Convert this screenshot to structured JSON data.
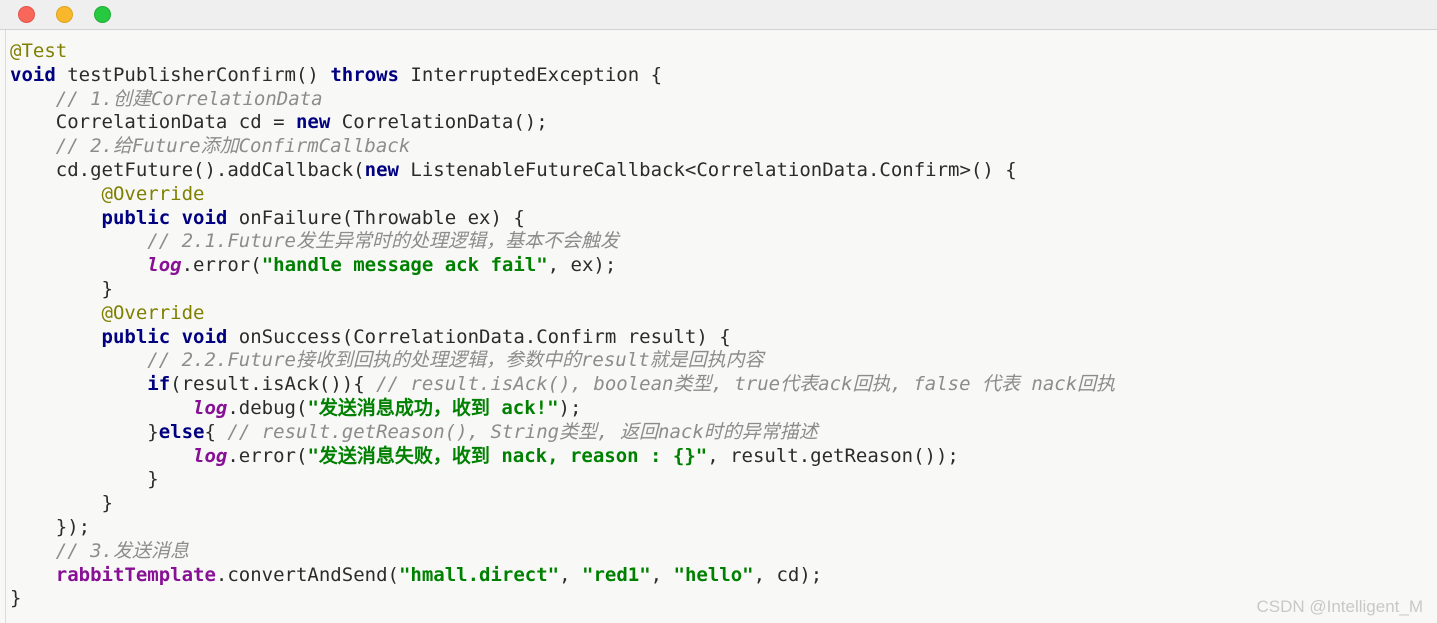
{
  "window": {
    "controls": [
      {
        "name": "close",
        "color": "#f9675a"
      },
      {
        "name": "minimize",
        "color": "#f9b82b"
      },
      {
        "name": "maximize",
        "color": "#26c940"
      }
    ]
  },
  "watermark": "CSDN @Intelligent_M",
  "editor": {
    "language": "java",
    "colors": {
      "background": "#f8f9f7",
      "text": "#2b2b2b",
      "keyword": "#000080",
      "annotation": "#808000",
      "comment": "#8c8c8c",
      "string": "#008000",
      "field": "#871094"
    },
    "lines": [
      {
        "n": 1,
        "indent": 0,
        "tokens": [
          {
            "t": "ann",
            "v": "@Test"
          }
        ]
      },
      {
        "n": 2,
        "indent": 0,
        "tokens": [
          {
            "t": "kw",
            "v": "void"
          },
          {
            "t": "pln",
            "v": " testPublisherConfirm() "
          },
          {
            "t": "kw",
            "v": "throws"
          },
          {
            "t": "pln",
            "v": " InterruptedException {"
          }
        ]
      },
      {
        "n": 3,
        "indent": 1,
        "tokens": [
          {
            "t": "cmt",
            "v": "// 1.创建CorrelationData"
          }
        ]
      },
      {
        "n": 4,
        "indent": 1,
        "tokens": [
          {
            "t": "pln",
            "v": "CorrelationData cd = "
          },
          {
            "t": "kw",
            "v": "new"
          },
          {
            "t": "pln",
            "v": " CorrelationData();"
          }
        ]
      },
      {
        "n": 5,
        "indent": 1,
        "tokens": [
          {
            "t": "cmt",
            "v": "// 2.给Future添加ConfirmCallback"
          }
        ]
      },
      {
        "n": 6,
        "indent": 1,
        "tokens": [
          {
            "t": "pln",
            "v": "cd.getFuture().addCallback("
          },
          {
            "t": "kw",
            "v": "new"
          },
          {
            "t": "pln",
            "v": " ListenableFutureCallback<CorrelationData.Confirm>() {"
          }
        ]
      },
      {
        "n": 7,
        "indent": 2,
        "tokens": [
          {
            "t": "ann",
            "v": "@Override"
          }
        ]
      },
      {
        "n": 8,
        "indent": 2,
        "tokens": [
          {
            "t": "kw",
            "v": "public void"
          },
          {
            "t": "pln",
            "v": " onFailure(Throwable ex) {"
          }
        ]
      },
      {
        "n": 9,
        "indent": 3,
        "tokens": [
          {
            "t": "cmt",
            "v": "// 2.1.Future发生异常时的处理逻辑，基本不会触发"
          }
        ]
      },
      {
        "n": 10,
        "indent": 3,
        "tokens": [
          {
            "t": "fld",
            "v": "log"
          },
          {
            "t": "pln",
            "v": ".error("
          },
          {
            "t": "str",
            "v": "\"handle message ack fail\""
          },
          {
            "t": "pln",
            "v": ", ex);"
          }
        ]
      },
      {
        "n": 11,
        "indent": 2,
        "tokens": [
          {
            "t": "pln",
            "v": "}"
          }
        ]
      },
      {
        "n": 12,
        "indent": 2,
        "tokens": [
          {
            "t": "ann",
            "v": "@Override"
          }
        ]
      },
      {
        "n": 13,
        "indent": 2,
        "tokens": [
          {
            "t": "kw",
            "v": "public void"
          },
          {
            "t": "pln",
            "v": " onSuccess(CorrelationData.Confirm result) {"
          }
        ]
      },
      {
        "n": 14,
        "indent": 3,
        "tokens": [
          {
            "t": "cmt",
            "v": "// 2.2.Future接收到回执的处理逻辑，参数中的result就是回执内容"
          }
        ]
      },
      {
        "n": 15,
        "indent": 3,
        "tokens": [
          {
            "t": "kw",
            "v": "if"
          },
          {
            "t": "pln",
            "v": "(result.isAck()){ "
          },
          {
            "t": "cmt",
            "v": "// result.isAck(), boolean类型, true代表ack回执, false 代表 nack回执"
          }
        ]
      },
      {
        "n": 16,
        "indent": 4,
        "tokens": [
          {
            "t": "fld",
            "v": "log"
          },
          {
            "t": "pln",
            "v": ".debug("
          },
          {
            "t": "str",
            "v": "\"发送消息成功，收到 ack!\""
          },
          {
            "t": "pln",
            "v": ");"
          }
        ]
      },
      {
        "n": 17,
        "indent": 3,
        "tokens": [
          {
            "t": "pln",
            "v": "}"
          },
          {
            "t": "kw",
            "v": "else"
          },
          {
            "t": "pln",
            "v": "{ "
          },
          {
            "t": "cmt",
            "v": "// result.getReason(), String类型, 返回nack时的异常描述"
          }
        ]
      },
      {
        "n": 18,
        "indent": 4,
        "tokens": [
          {
            "t": "fld",
            "v": "log"
          },
          {
            "t": "pln",
            "v": ".error("
          },
          {
            "t": "str",
            "v": "\"发送消息失败，收到 nack, reason : {}\""
          },
          {
            "t": "pln",
            "v": ", result.getReason());"
          }
        ]
      },
      {
        "n": 19,
        "indent": 3,
        "tokens": [
          {
            "t": "pln",
            "v": "}"
          }
        ]
      },
      {
        "n": 20,
        "indent": 2,
        "tokens": [
          {
            "t": "pln",
            "v": "}"
          }
        ]
      },
      {
        "n": 21,
        "indent": 1,
        "tokens": [
          {
            "t": "pln",
            "v": "});"
          }
        ]
      },
      {
        "n": 22,
        "indent": 1,
        "tokens": [
          {
            "t": "cmt",
            "v": "// 3.发送消息"
          }
        ]
      },
      {
        "n": 23,
        "indent": 1,
        "tokens": [
          {
            "t": "fld2",
            "v": "rabbitTemplate"
          },
          {
            "t": "pln",
            "v": ".convertAndSend("
          },
          {
            "t": "str",
            "v": "\"hmall.direct\""
          },
          {
            "t": "pln",
            "v": ", "
          },
          {
            "t": "str",
            "v": "\"red1\""
          },
          {
            "t": "pln",
            "v": ", "
          },
          {
            "t": "str",
            "v": "\"hello\""
          },
          {
            "t": "pln",
            "v": ", cd);"
          }
        ]
      },
      {
        "n": 24,
        "indent": 0,
        "tokens": [
          {
            "t": "pln",
            "v": "}"
          }
        ]
      }
    ]
  }
}
